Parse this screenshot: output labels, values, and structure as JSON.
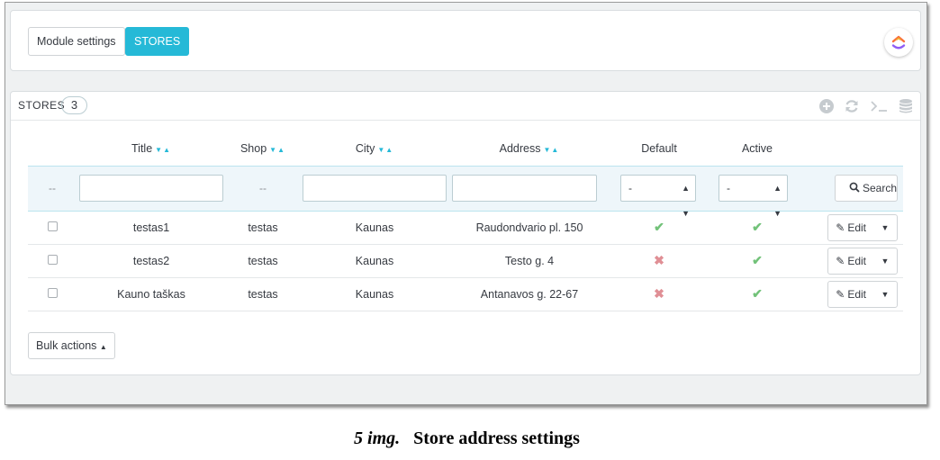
{
  "tabs": {
    "module_settings": "Module settings",
    "stores": "STORES"
  },
  "list": {
    "title": "STORES",
    "count": "3",
    "toolbar_icons": [
      "add-icon",
      "refresh-icon",
      "sql-query-icon",
      "database-icon"
    ]
  },
  "table": {
    "columns": [
      "Title",
      "Shop",
      "City",
      "Address",
      "Default",
      "Active"
    ],
    "filter": {
      "id_placeholder": "--",
      "shop_placeholder": "--",
      "default_value": "-",
      "active_value": "-",
      "search_label": "Search"
    },
    "rows": [
      {
        "title": "testas1",
        "shop": "testas",
        "city": "Kaunas",
        "address": "Raudondvario pl. 150",
        "default": "yes",
        "active": "yes"
      },
      {
        "title": "testas2",
        "shop": "testas",
        "city": "Kaunas",
        "address": "Testo g. 4",
        "default": "no",
        "active": "yes"
      },
      {
        "title": "Kauno taškas",
        "shop": "testas",
        "city": "Kaunas",
        "address": "Antanavos g. 22-67",
        "default": "no",
        "active": "yes"
      }
    ],
    "edit_label": "Edit"
  },
  "bulk_actions": "Bulk actions",
  "caption": {
    "number": "5 img.",
    "text": "Store address settings"
  },
  "colors": {
    "accent": "#25b9d7",
    "check": "#72c279",
    "cross": "#e08f95"
  }
}
